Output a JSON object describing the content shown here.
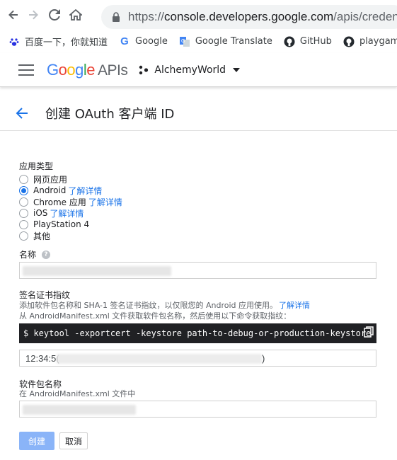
{
  "browser": {
    "url_prefix": "https://",
    "url_host": "console.developers.google.com",
    "url_path": "/apis/credentials/o",
    "bookmarks": [
      {
        "label": "百度一下，你就知道",
        "icon": "baidu-paw-icon"
      },
      {
        "label": "Google",
        "icon": "google-g-icon"
      },
      {
        "label": "Google Translate",
        "icon": "google-translate-icon"
      },
      {
        "label": "GitHub",
        "icon": "github-icon"
      },
      {
        "label": "playgameser",
        "icon": "github-icon"
      }
    ]
  },
  "header": {
    "logo_google": "Google",
    "logo_apis": "APIs",
    "project_name": "AlchemyWorld"
  },
  "page": {
    "title": "创建 OAuth 客户端 ID"
  },
  "form": {
    "app_type_label": "应用类型",
    "options": [
      {
        "label": "网页应用",
        "link": "",
        "checked": false
      },
      {
        "label": "Android",
        "link": "了解详情",
        "checked": true
      },
      {
        "label": "Chrome 应用",
        "link": "了解详情",
        "checked": false
      },
      {
        "label": "iOS",
        "link": "了解详情",
        "checked": false
      },
      {
        "label": "PlayStation 4",
        "link": "",
        "checked": false
      },
      {
        "label": "其他",
        "link": "",
        "checked": false
      }
    ],
    "name_label": "名称",
    "signature_label": "签名证书指纹",
    "signature_desc_1": "添加软件包名称和 SHA-1 签名证书指纹，以仅限您的 Android 应用使用。",
    "signature_desc_link": "了解详情",
    "signature_desc_2": "从 AndroidManifest.xml 文件获取软件包名称，然后使用以下命令获取指纹：",
    "command": "$ keytool -exportcert -keystore path-to-debug-or-production-keystore -list -v",
    "sha1_visible_start": "12:34:5(",
    "sha1_visible_end": ")",
    "package_label": "软件包名称",
    "package_sub": "在 AndroidManifest.xml 文件中"
  },
  "buttons": {
    "create": "创建",
    "cancel": "取消"
  },
  "colors": {
    "accent": "#1a73e8",
    "create_button": "#8ab4f8",
    "command_bg": "#202124"
  }
}
